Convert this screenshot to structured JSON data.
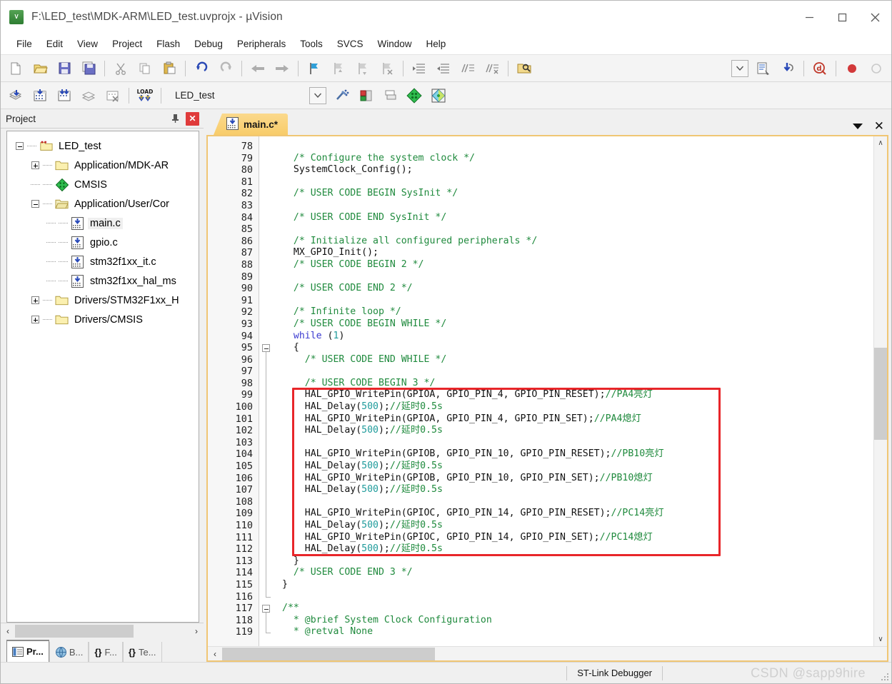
{
  "window": {
    "title": "F:\\LED_test\\MDK-ARM\\LED_test.uvprojx - µVision",
    "app_icon": "uvision-icon",
    "minimize_label": "—",
    "maximize_label": "□",
    "close_label": "✕"
  },
  "menubar": {
    "items": [
      {
        "label": "File"
      },
      {
        "label": "Edit"
      },
      {
        "label": "View"
      },
      {
        "label": "Project"
      },
      {
        "label": "Flash"
      },
      {
        "label": "Debug"
      },
      {
        "label": "Peripherals"
      },
      {
        "label": "Tools"
      },
      {
        "label": "SVCS"
      },
      {
        "label": "Window"
      },
      {
        "label": "Help"
      }
    ]
  },
  "toolbar_main": {
    "buttons": [
      {
        "name": "new-file-icon",
        "tip": "New"
      },
      {
        "name": "open-file-icon",
        "tip": "Open"
      },
      {
        "name": "save-icon",
        "tip": "Save"
      },
      {
        "name": "save-all-icon",
        "tip": "Save All"
      },
      {
        "name": "cut-icon",
        "tip": "Cut"
      },
      {
        "name": "copy-icon",
        "tip": "Copy"
      },
      {
        "name": "paste-icon",
        "tip": "Paste"
      },
      {
        "name": "undo-icon",
        "tip": "Undo"
      },
      {
        "name": "redo-icon",
        "tip": "Redo"
      },
      {
        "name": "navigate-back-icon",
        "tip": "Back"
      },
      {
        "name": "navigate-forward-icon",
        "tip": "Forward"
      },
      {
        "name": "bookmark-toggle-icon",
        "tip": "Insert/Remove Bookmark"
      },
      {
        "name": "bookmark-prev-icon",
        "tip": "Previous Bookmark"
      },
      {
        "name": "bookmark-next-icon",
        "tip": "Next Bookmark"
      },
      {
        "name": "bookmark-clear-icon",
        "tip": "Clear All Bookmarks"
      },
      {
        "name": "indent-right-icon",
        "tip": "Indent"
      },
      {
        "name": "indent-left-icon",
        "tip": "Outdent"
      },
      {
        "name": "comment-icon",
        "tip": "Comment"
      },
      {
        "name": "uncomment-icon",
        "tip": "Uncomment"
      },
      {
        "name": "find-in-files-icon",
        "tip": "Find in Files"
      }
    ],
    "right_buttons": [
      {
        "name": "combo-dropdown-icon",
        "tip": "Select"
      },
      {
        "name": "configure-icon",
        "tip": "Configure"
      },
      {
        "name": "download-icon",
        "tip": "Download"
      },
      {
        "name": "debug-session-icon",
        "tip": "Start/Stop Debug Session"
      },
      {
        "name": "record-icon",
        "tip": "Record"
      },
      {
        "name": "stop-icon",
        "tip": "Stop"
      }
    ]
  },
  "toolbar_build": {
    "buttons": [
      {
        "name": "translate-icon",
        "tip": "Translate"
      },
      {
        "name": "build-icon",
        "tip": "Build"
      },
      {
        "name": "rebuild-icon",
        "tip": "Rebuild"
      },
      {
        "name": "batch-build-icon",
        "tip": "Batch Build"
      },
      {
        "name": "stop-build-icon",
        "tip": "Stop Build"
      },
      {
        "name": "load-icon",
        "tip": "Download",
        "label": "LOAD"
      }
    ],
    "target_value": "LED_test",
    "right_buttons": [
      {
        "name": "target-options-icon",
        "tip": "Options for Target"
      },
      {
        "name": "manage-project-items-icon",
        "tip": "Manage Project Items"
      },
      {
        "name": "pack-installer-icon",
        "tip": "Pack Installer"
      },
      {
        "name": "manage-runtime-env-icon",
        "tip": "Manage Run-Time Environment"
      }
    ]
  },
  "project_pane": {
    "title": "Project",
    "pin_icon": "pin-icon",
    "close_icon": "close-icon",
    "tree": [
      {
        "label": "LED_test",
        "depth": 0,
        "icon": "project-folder-icon",
        "state": "expanded"
      },
      {
        "label": "Application/MDK-AR",
        "depth": 1,
        "icon": "folder-icon",
        "state": "collapsed"
      },
      {
        "label": "CMSIS",
        "depth": 1,
        "icon": "cmsis-diamond-icon",
        "state": "leaf"
      },
      {
        "label": "Application/User/Cor",
        "depth": 1,
        "icon": "folder-open-icon",
        "state": "expanded"
      },
      {
        "label": "main.c",
        "depth": 2,
        "icon": "c-file-icon",
        "state": "leaf",
        "selected": true
      },
      {
        "label": "gpio.c",
        "depth": 2,
        "icon": "c-file-icon",
        "state": "leaf"
      },
      {
        "label": "stm32f1xx_it.c",
        "depth": 2,
        "icon": "c-file-icon",
        "state": "leaf"
      },
      {
        "label": "stm32f1xx_hal_ms",
        "depth": 2,
        "icon": "c-file-icon",
        "state": "leaf"
      },
      {
        "label": "Drivers/STM32F1xx_H",
        "depth": 1,
        "icon": "folder-icon",
        "state": "collapsed"
      },
      {
        "label": "Drivers/CMSIS",
        "depth": 1,
        "icon": "folder-icon",
        "state": "collapsed"
      }
    ],
    "hscroll_left_arrow": "‹",
    "hscroll_right_arrow": "›",
    "bottom_tabs": [
      {
        "label": "Pr...",
        "icon": "project-tab-icon",
        "active": true
      },
      {
        "label": "B...",
        "icon": "books-tab-icon",
        "active": false
      },
      {
        "label": "F...",
        "icon": "functions-tab-icon",
        "active": false,
        "prefix": "{}"
      },
      {
        "label": "Te...",
        "icon": "templates-tab-icon",
        "active": false,
        "prefix": "{}"
      }
    ]
  },
  "editor": {
    "tabs": [
      {
        "label": "main.c*",
        "icon": "c-file-icon",
        "active": true
      }
    ],
    "tab_dropdown_icon": "chevron-down-icon",
    "tab_close_icon": "close-icon",
    "first_line_number": 78,
    "scroll_up_arrow": "∧",
    "scroll_down_arrow": "∨",
    "hscroll_left_arrow": "‹",
    "highlight_box_color": "#e8262a",
    "colors": {
      "comment": "#1f8a3d",
      "keyword": "#3a3ad0",
      "number": "#1f9b9b",
      "text": "#111111",
      "gutter_bg": "#f7f7f7",
      "frame": "#f0c674"
    },
    "lines": [
      {
        "n": 78,
        "tokens": []
      },
      {
        "n": 79,
        "tokens": [
          {
            "t": "  ",
            "c": "txt"
          },
          {
            "t": "/* Configure the system clock */",
            "c": "cmt"
          }
        ]
      },
      {
        "n": 80,
        "tokens": [
          {
            "t": "  SystemClock_Config();",
            "c": "txt"
          }
        ]
      },
      {
        "n": 81,
        "tokens": []
      },
      {
        "n": 82,
        "tokens": [
          {
            "t": "  ",
            "c": "txt"
          },
          {
            "t": "/* USER CODE BEGIN SysInit */",
            "c": "cmt"
          }
        ]
      },
      {
        "n": 83,
        "tokens": []
      },
      {
        "n": 84,
        "tokens": [
          {
            "t": "  ",
            "c": "txt"
          },
          {
            "t": "/* USER CODE END SysInit */",
            "c": "cmt"
          }
        ]
      },
      {
        "n": 85,
        "tokens": []
      },
      {
        "n": 86,
        "tokens": [
          {
            "t": "  ",
            "c": "txt"
          },
          {
            "t": "/* Initialize all configured peripherals */",
            "c": "cmt"
          }
        ]
      },
      {
        "n": 87,
        "tokens": [
          {
            "t": "  MX_GPIO_Init();",
            "c": "txt"
          }
        ]
      },
      {
        "n": 88,
        "tokens": [
          {
            "t": "  ",
            "c": "txt"
          },
          {
            "t": "/* USER CODE BEGIN 2 */",
            "c": "cmt"
          }
        ]
      },
      {
        "n": 89,
        "tokens": []
      },
      {
        "n": 90,
        "tokens": [
          {
            "t": "  ",
            "c": "txt"
          },
          {
            "t": "/* USER CODE END 2 */",
            "c": "cmt"
          }
        ]
      },
      {
        "n": 91,
        "tokens": []
      },
      {
        "n": 92,
        "tokens": [
          {
            "t": "  ",
            "c": "txt"
          },
          {
            "t": "/* Infinite loop */",
            "c": "cmt"
          }
        ]
      },
      {
        "n": 93,
        "tokens": [
          {
            "t": "  ",
            "c": "txt"
          },
          {
            "t": "/* USER CODE BEGIN WHILE */",
            "c": "cmt"
          }
        ]
      },
      {
        "n": 94,
        "tokens": [
          {
            "t": "  ",
            "c": "txt"
          },
          {
            "t": "while",
            "c": "kw"
          },
          {
            "t": " (",
            "c": "txt"
          },
          {
            "t": "1",
            "c": "num"
          },
          {
            "t": ")",
            "c": "txt"
          }
        ]
      },
      {
        "n": 95,
        "tokens": [
          {
            "t": "  {",
            "c": "txt"
          }
        ],
        "fold": true
      },
      {
        "n": 96,
        "tokens": [
          {
            "t": "    ",
            "c": "txt"
          },
          {
            "t": "/* USER CODE END WHILE */",
            "c": "cmt"
          }
        ]
      },
      {
        "n": 97,
        "tokens": []
      },
      {
        "n": 98,
        "tokens": [
          {
            "t": "    ",
            "c": "txt"
          },
          {
            "t": "/* USER CODE BEGIN 3 */",
            "c": "cmt"
          }
        ]
      },
      {
        "n": 99,
        "tokens": [
          {
            "t": "    HAL_GPIO_WritePin(GPIOA, GPIO_PIN_4, GPIO_PIN_RESET);",
            "c": "txt"
          },
          {
            "t": "//PA4亮灯",
            "c": "cmt"
          }
        ]
      },
      {
        "n": 100,
        "tokens": [
          {
            "t": "    HAL_Delay(",
            "c": "txt"
          },
          {
            "t": "500",
            "c": "num"
          },
          {
            "t": ");",
            "c": "txt"
          },
          {
            "t": "//延时0.5s",
            "c": "cmt"
          }
        ]
      },
      {
        "n": 101,
        "tokens": [
          {
            "t": "    HAL_GPIO_WritePin(GPIOA, GPIO_PIN_4, GPIO_PIN_SET);",
            "c": "txt"
          },
          {
            "t": "//PA4熄灯",
            "c": "cmt"
          }
        ]
      },
      {
        "n": 102,
        "tokens": [
          {
            "t": "    HAL_Delay(",
            "c": "txt"
          },
          {
            "t": "500",
            "c": "num"
          },
          {
            "t": ");",
            "c": "txt"
          },
          {
            "t": "//延时0.5s",
            "c": "cmt"
          }
        ]
      },
      {
        "n": 103,
        "tokens": []
      },
      {
        "n": 104,
        "tokens": [
          {
            "t": "    HAL_GPIO_WritePin(GPIOB, GPIO_PIN_10, GPIO_PIN_RESET);",
            "c": "txt"
          },
          {
            "t": "//PB10亮灯",
            "c": "cmt"
          }
        ]
      },
      {
        "n": 105,
        "tokens": [
          {
            "t": "    HAL_Delay(",
            "c": "txt"
          },
          {
            "t": "500",
            "c": "num"
          },
          {
            "t": ");",
            "c": "txt"
          },
          {
            "t": "//延时0.5s",
            "c": "cmt"
          }
        ]
      },
      {
        "n": 106,
        "tokens": [
          {
            "t": "    HAL_GPIO_WritePin(GPIOB, GPIO_PIN_10, GPIO_PIN_SET);",
            "c": "txt"
          },
          {
            "t": "//PB10熄灯",
            "c": "cmt"
          }
        ]
      },
      {
        "n": 107,
        "tokens": [
          {
            "t": "    HAL_Delay(",
            "c": "txt"
          },
          {
            "t": "500",
            "c": "num"
          },
          {
            "t": ");",
            "c": "txt"
          },
          {
            "t": "//延时0.5s",
            "c": "cmt"
          }
        ]
      },
      {
        "n": 108,
        "tokens": []
      },
      {
        "n": 109,
        "tokens": [
          {
            "t": "    HAL_GPIO_WritePin(GPIOC, GPIO_PIN_14, GPIO_PIN_RESET);",
            "c": "txt"
          },
          {
            "t": "//PC14亮灯",
            "c": "cmt"
          }
        ]
      },
      {
        "n": 110,
        "tokens": [
          {
            "t": "    HAL_Delay(",
            "c": "txt"
          },
          {
            "t": "500",
            "c": "num"
          },
          {
            "t": ");",
            "c": "txt"
          },
          {
            "t": "//延时0.5s",
            "c": "cmt"
          }
        ]
      },
      {
        "n": 111,
        "tokens": [
          {
            "t": "    HAL_GPIO_WritePin(GPIOC, GPIO_PIN_14, GPIO_PIN_SET);",
            "c": "txt"
          },
          {
            "t": "//PC14熄灯",
            "c": "cmt"
          }
        ]
      },
      {
        "n": 112,
        "tokens": [
          {
            "t": "    HAL_Delay(",
            "c": "txt"
          },
          {
            "t": "500",
            "c": "num"
          },
          {
            "t": ");",
            "c": "txt"
          },
          {
            "t": "//延时0.5s",
            "c": "cmt"
          }
        ]
      },
      {
        "n": 113,
        "tokens": [
          {
            "t": "  }",
            "c": "txt"
          }
        ]
      },
      {
        "n": 114,
        "tokens": [
          {
            "t": "  ",
            "c": "txt"
          },
          {
            "t": "/* USER CODE END 3 */",
            "c": "cmt"
          }
        ]
      },
      {
        "n": 115,
        "tokens": [
          {
            "t": "}",
            "c": "txt"
          }
        ]
      },
      {
        "n": 116,
        "tokens": []
      },
      {
        "n": 117,
        "tokens": [
          {
            "t": "/**",
            "c": "cmt"
          }
        ],
        "fold": true
      },
      {
        "n": 118,
        "tokens": [
          {
            "t": "  * @brief System Clock Configuration",
            "c": "cmt"
          }
        ]
      },
      {
        "n": 119,
        "tokens": [
          {
            "t": "  * @retval None",
            "c": "cmt"
          }
        ]
      }
    ]
  },
  "statusbar": {
    "debugger": "ST-Link Debugger",
    "watermark": "CSDN @sapp9hire"
  }
}
